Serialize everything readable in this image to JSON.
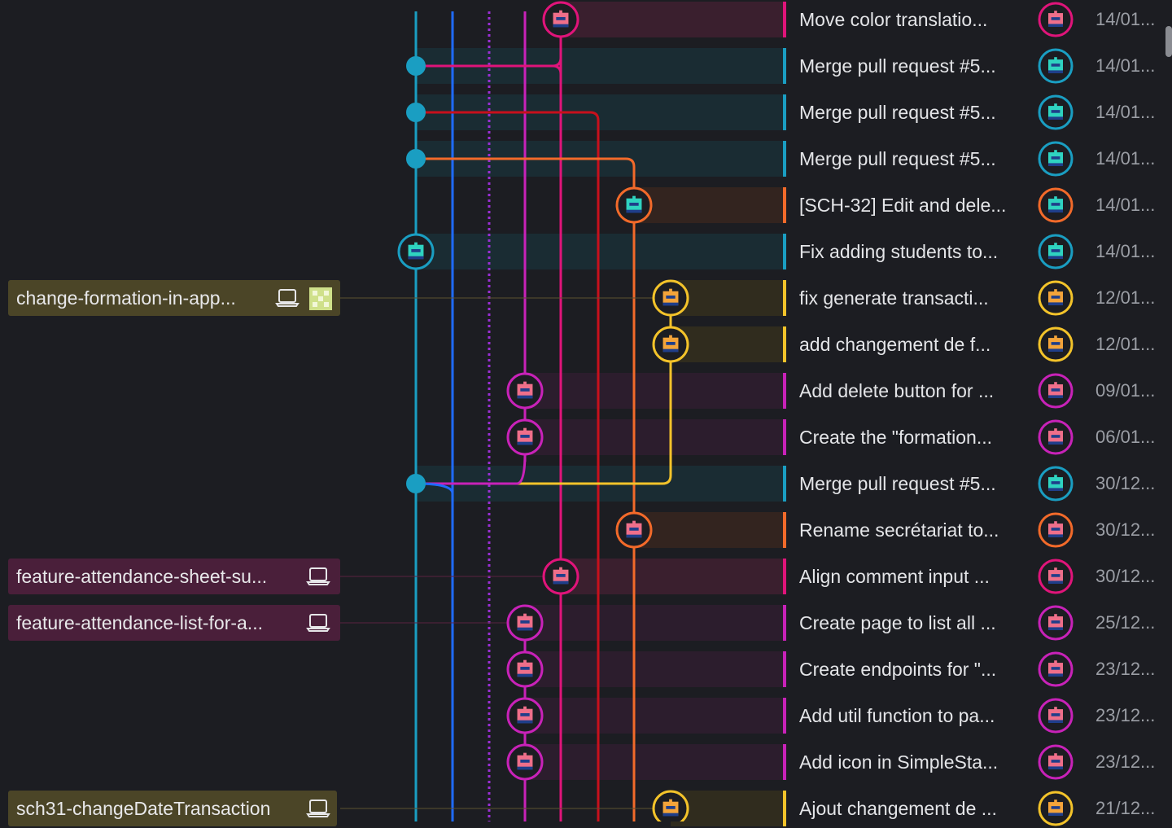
{
  "colors": {
    "background": "#1c1d22",
    "lane_teal": "#1a9ec2",
    "lane_blue": "#1f6bff",
    "lane_purple_dotted": "#9b2fd6",
    "lane_magenta": "#c822b8",
    "lane_pink": "#e0147a",
    "lane_red": "#c8101c",
    "lane_orange": "#f26a2a",
    "lane_yellow": "#f3c32a"
  },
  "branch_labels": [
    {
      "text": "change-formation-in-app...",
      "icon": "laptop-icon",
      "avatar": "green-pixel-avatar-icon",
      "color": "#4b4527"
    },
    {
      "text": "feature-attendance-sheet-su...",
      "icon": "laptop-icon",
      "color": "#4a1f3a"
    },
    {
      "text": "feature-attendance-list-for-a...",
      "icon": "laptop-icon",
      "color": "#4a1f3a"
    },
    {
      "text": "sch31-changeDateTransaction",
      "icon": "laptop-icon",
      "color": "#4b4527"
    }
  ],
  "commits": [
    {
      "message": "Move color translatio...",
      "date": "14/01...",
      "lane_color": "#e0147a",
      "avatar": "pink-pixel-avatar-icon"
    },
    {
      "message": "Merge pull request #5...",
      "date": "14/01...",
      "lane_color": "#1a9ec2",
      "avatar": "teal-pixel-avatar-icon"
    },
    {
      "message": "Merge pull request #5...",
      "date": "14/01...",
      "lane_color": "#1a9ec2",
      "avatar": "teal-pixel-avatar-icon"
    },
    {
      "message": "Merge pull request #5...",
      "date": "14/01...",
      "lane_color": "#1a9ec2",
      "avatar": "teal-pixel-avatar-icon"
    },
    {
      "message": "[SCH-32] Edit and dele...",
      "date": "14/01...",
      "lane_color": "#f26a2a",
      "avatar": "teal-pixel-avatar-icon"
    },
    {
      "message": "Fix adding students to...",
      "date": "14/01...",
      "lane_color": "#1a9ec2",
      "avatar": "teal-pixel-avatar-icon"
    },
    {
      "message": "fix generate transacti...",
      "date": "12/01...",
      "lane_color": "#f3c32a",
      "avatar": "orange-pixel-avatar-icon"
    },
    {
      "message": "add changement de f...",
      "date": "12/01...",
      "lane_color": "#f3c32a",
      "avatar": "orange-pixel-avatar-icon"
    },
    {
      "message": "Add delete button for ...",
      "date": "09/01...",
      "lane_color": "#c822b8",
      "avatar": "pink-pixel-avatar-icon"
    },
    {
      "message": "Create the \"formation...",
      "date": "06/01...",
      "lane_color": "#c822b8",
      "avatar": "pink-pixel-avatar-icon"
    },
    {
      "message": "Merge pull request #5...",
      "date": "30/12...",
      "lane_color": "#1a9ec2",
      "avatar": "teal-pixel-avatar-icon"
    },
    {
      "message": "Rename secrétariat to...",
      "date": "30/12...",
      "lane_color": "#f26a2a",
      "avatar": "pink-pixel-avatar-icon"
    },
    {
      "message": "Align comment input ...",
      "date": "30/12...",
      "lane_color": "#e0147a",
      "avatar": "pink-pixel-avatar-icon"
    },
    {
      "message": "Create page to list all ...",
      "date": "25/12...",
      "lane_color": "#c822b8",
      "avatar": "pink-pixel-avatar-icon"
    },
    {
      "message": "Create endpoints for \"...",
      "date": "23/12...",
      "lane_color": "#c822b8",
      "avatar": "pink-pixel-avatar-icon"
    },
    {
      "message": "Add util function to pa...",
      "date": "23/12...",
      "lane_color": "#c822b8",
      "avatar": "pink-pixel-avatar-icon"
    },
    {
      "message": "Add icon in SimpleSta...",
      "date": "23/12...",
      "lane_color": "#c822b8",
      "avatar": "pink-pixel-avatar-icon"
    },
    {
      "message": "Ajout changement de ...",
      "date": "21/12...",
      "lane_color": "#f3c32a",
      "avatar": "orange-pixel-avatar-icon"
    }
  ]
}
